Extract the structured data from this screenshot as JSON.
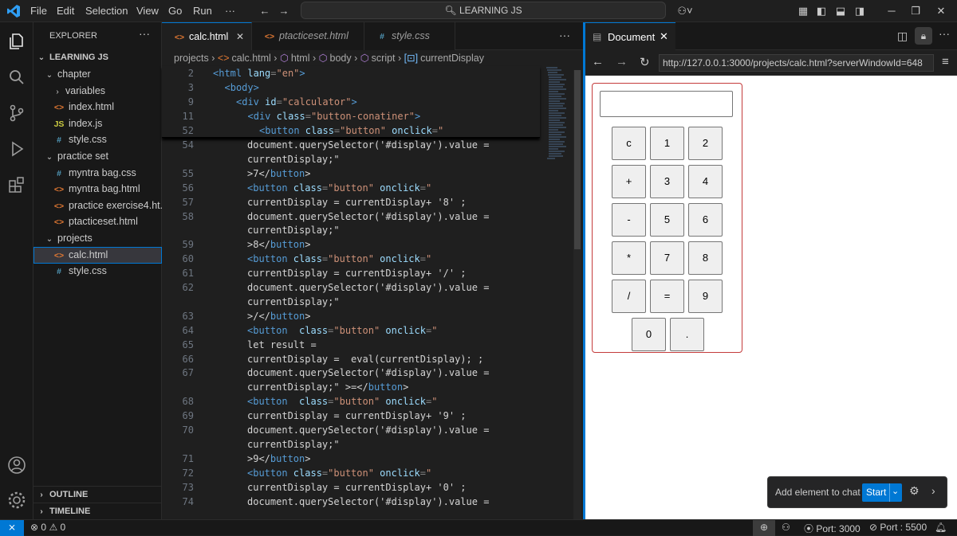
{
  "menu": [
    "File",
    "Edit",
    "Selection",
    "View",
    "Go",
    "Run",
    "···"
  ],
  "search": {
    "label": "LEARNING JS"
  },
  "explorer": {
    "title": "EXPLORER",
    "root": "LEARNING JS",
    "items": [
      {
        "label": "chapter",
        "type": "folder-open",
        "indent": 1
      },
      {
        "label": "variables",
        "type": "folder-closed",
        "indent": 2
      },
      {
        "label": "index.html",
        "type": "html",
        "indent": 2,
        "icon": "<>"
      },
      {
        "label": "index.js",
        "type": "js",
        "indent": 2,
        "icon": "JS"
      },
      {
        "label": "style.css",
        "type": "css",
        "indent": 2,
        "icon": "#"
      },
      {
        "label": "practice set",
        "type": "folder-open",
        "indent": 1
      },
      {
        "label": "myntra bag.css",
        "type": "css",
        "indent": 2,
        "icon": "#"
      },
      {
        "label": "myntra bag.html",
        "type": "html",
        "indent": 2,
        "icon": "<>"
      },
      {
        "label": "practice exercise4.ht...",
        "type": "html",
        "indent": 2,
        "icon": "<>"
      },
      {
        "label": "ptacticeset.html",
        "type": "html",
        "indent": 2,
        "icon": "<>"
      },
      {
        "label": "projects",
        "type": "folder-open",
        "indent": 1
      },
      {
        "label": "calc.html",
        "type": "html",
        "indent": 2,
        "icon": "<>",
        "selected": true
      },
      {
        "label": "style.css",
        "type": "css",
        "indent": 2,
        "icon": "#"
      }
    ],
    "outline": "OUTLINE",
    "timeline": "TIMELINE"
  },
  "tabs": [
    {
      "label": "calc.html",
      "icon": "<>",
      "active": true,
      "close": "✕"
    },
    {
      "label": "ptacticeset.html",
      "icon": "<>",
      "active": false
    },
    {
      "label": "style.css",
      "icon": "#",
      "active": false
    }
  ],
  "breadcrumb": [
    "projects",
    "calc.html",
    "html",
    "body",
    "script",
    "currentDisplay"
  ],
  "sticky": [
    {
      "n": "2",
      "parts": [
        [
          "tg",
          "<html "
        ],
        [
          "at",
          "lang"
        ],
        [
          "pu",
          "="
        ],
        [
          "st",
          "\"en\""
        ],
        [
          "tg",
          ">"
        ]
      ],
      "indent": 0
    },
    {
      "n": "3",
      "parts": [
        [
          "tg",
          "<body>"
        ]
      ],
      "indent": 1
    },
    {
      "n": "9",
      "parts": [
        [
          "tg",
          "<div "
        ],
        [
          "at",
          "id"
        ],
        [
          "pu",
          "="
        ],
        [
          "st",
          "\"calculator\""
        ],
        [
          "tg",
          ">"
        ]
      ],
      "indent": 2
    },
    {
      "n": "11",
      "parts": [
        [
          "tg",
          "<div "
        ],
        [
          "at",
          "class"
        ],
        [
          "pu",
          "="
        ],
        [
          "st",
          "\"button-conatiner\""
        ],
        [
          "tg",
          ">"
        ]
      ],
      "indent": 3
    },
    {
      "n": "52",
      "parts": [
        [
          "tg",
          "<button "
        ],
        [
          "at",
          "class"
        ],
        [
          "pu",
          "="
        ],
        [
          "st",
          "\"button\""
        ],
        [
          "at",
          " onclick"
        ],
        [
          "pu",
          "="
        ],
        [
          "st",
          "\""
        ]
      ],
      "indent": 4
    }
  ],
  "code": [
    {
      "n": "54",
      "parts": [
        [
          "tx",
          "document.querySelector('#display').value ="
        ]
      ]
    },
    {
      "n": "",
      "parts": [
        [
          "tx",
          "currentDisplay;\""
        ]
      ]
    },
    {
      "n": "55",
      "parts": [
        [
          "tx",
          ">7</"
        ],
        [
          "tg",
          "button"
        ],
        [
          "tx",
          ">"
        ]
      ]
    },
    {
      "n": "56",
      "parts": [
        [
          "tg",
          "<button "
        ],
        [
          "at",
          "class"
        ],
        [
          "pu",
          "="
        ],
        [
          "st",
          "\"button\""
        ],
        [
          "at",
          " onclick"
        ],
        [
          "pu",
          "="
        ],
        [
          "st",
          "\""
        ]
      ]
    },
    {
      "n": "57",
      "parts": [
        [
          "tx",
          "currentDisplay = currentDisplay+ '8' ;"
        ]
      ]
    },
    {
      "n": "58",
      "parts": [
        [
          "tx",
          "document.querySelector('#display').value ="
        ]
      ]
    },
    {
      "n": "",
      "parts": [
        [
          "tx",
          "currentDisplay;\""
        ]
      ]
    },
    {
      "n": "59",
      "parts": [
        [
          "tx",
          ">8</"
        ],
        [
          "tg",
          "button"
        ],
        [
          "tx",
          ">"
        ]
      ]
    },
    {
      "n": "60",
      "parts": [
        [
          "tg",
          "<button "
        ],
        [
          "at",
          "class"
        ],
        [
          "pu",
          "="
        ],
        [
          "st",
          "\"button\""
        ],
        [
          "at",
          " onclick"
        ],
        [
          "pu",
          "="
        ],
        [
          "st",
          "\""
        ]
      ]
    },
    {
      "n": "61",
      "parts": [
        [
          "tx",
          "currentDisplay = currentDisplay+ '/' ;"
        ]
      ]
    },
    {
      "n": "62",
      "parts": [
        [
          "tx",
          "document.querySelector('#display').value ="
        ]
      ]
    },
    {
      "n": "",
      "parts": [
        [
          "tx",
          "currentDisplay;\""
        ]
      ]
    },
    {
      "n": "63",
      "parts": [
        [
          "tx",
          ">/</"
        ],
        [
          "tg",
          "button"
        ],
        [
          "tx",
          ">"
        ]
      ]
    },
    {
      "n": "64",
      "parts": [
        [
          "tg",
          "<button  "
        ],
        [
          "at",
          "class"
        ],
        [
          "pu",
          "="
        ],
        [
          "st",
          "\"button\""
        ],
        [
          "at",
          " onclick"
        ],
        [
          "pu",
          "="
        ],
        [
          "st",
          "\""
        ]
      ]
    },
    {
      "n": "65",
      "parts": [
        [
          "tx",
          "let result ="
        ]
      ]
    },
    {
      "n": "66",
      "parts": [
        [
          "tx",
          "currentDisplay =  eval(currentDisplay); ;"
        ]
      ]
    },
    {
      "n": "67",
      "parts": [
        [
          "tx",
          "document.querySelector('#display').value ="
        ]
      ]
    },
    {
      "n": "",
      "parts": [
        [
          "tx",
          "currentDisplay;\" >=</"
        ],
        [
          "tg",
          "button"
        ],
        [
          "tx",
          ">"
        ]
      ]
    },
    {
      "n": "68",
      "parts": [
        [
          "tg",
          "<button  "
        ],
        [
          "at",
          "class"
        ],
        [
          "pu",
          "="
        ],
        [
          "st",
          "\"button\""
        ],
        [
          "at",
          " onclick"
        ],
        [
          "pu",
          "="
        ],
        [
          "st",
          "\""
        ]
      ]
    },
    {
      "n": "69",
      "parts": [
        [
          "tx",
          "currentDisplay = currentDisplay+ '9' ;"
        ]
      ]
    },
    {
      "n": "70",
      "parts": [
        [
          "tx",
          "document.querySelector('#display').value ="
        ]
      ]
    },
    {
      "n": "",
      "parts": [
        [
          "tx",
          "currentDisplay;\""
        ]
      ]
    },
    {
      "n": "71",
      "parts": [
        [
          "tx",
          ">9</"
        ],
        [
          "tg",
          "button"
        ],
        [
          "tx",
          ">"
        ]
      ]
    },
    {
      "n": "72",
      "parts": [
        [
          "tg",
          "<button "
        ],
        [
          "at",
          "class"
        ],
        [
          "pu",
          "="
        ],
        [
          "st",
          "\"button\""
        ],
        [
          "at",
          " onclick"
        ],
        [
          "pu",
          "="
        ],
        [
          "st",
          "\""
        ]
      ]
    },
    {
      "n": "73",
      "parts": [
        [
          "tx",
          "currentDisplay = currentDisplay+ '0' ;"
        ]
      ]
    },
    {
      "n": "74",
      "parts": [
        [
          "tx",
          "document.querySelector('#display').value ="
        ]
      ]
    }
  ],
  "browser": {
    "tab_label": "Document",
    "url": "http://127.0.0.1:3000/projects/calc.html?serverWindowId=648"
  },
  "calculator": {
    "buttons": [
      "c",
      "1",
      "2",
      "+",
      "3",
      "4",
      "-",
      "5",
      "6",
      "*",
      "7",
      "8",
      "/",
      "=",
      "9",
      "0",
      "."
    ]
  },
  "chat": {
    "label": "Add element to chat",
    "start": "Start"
  },
  "status": {
    "errors": "0",
    "warnings": "0",
    "port1": "Port: 3000",
    "port2": "Port : 5500"
  }
}
